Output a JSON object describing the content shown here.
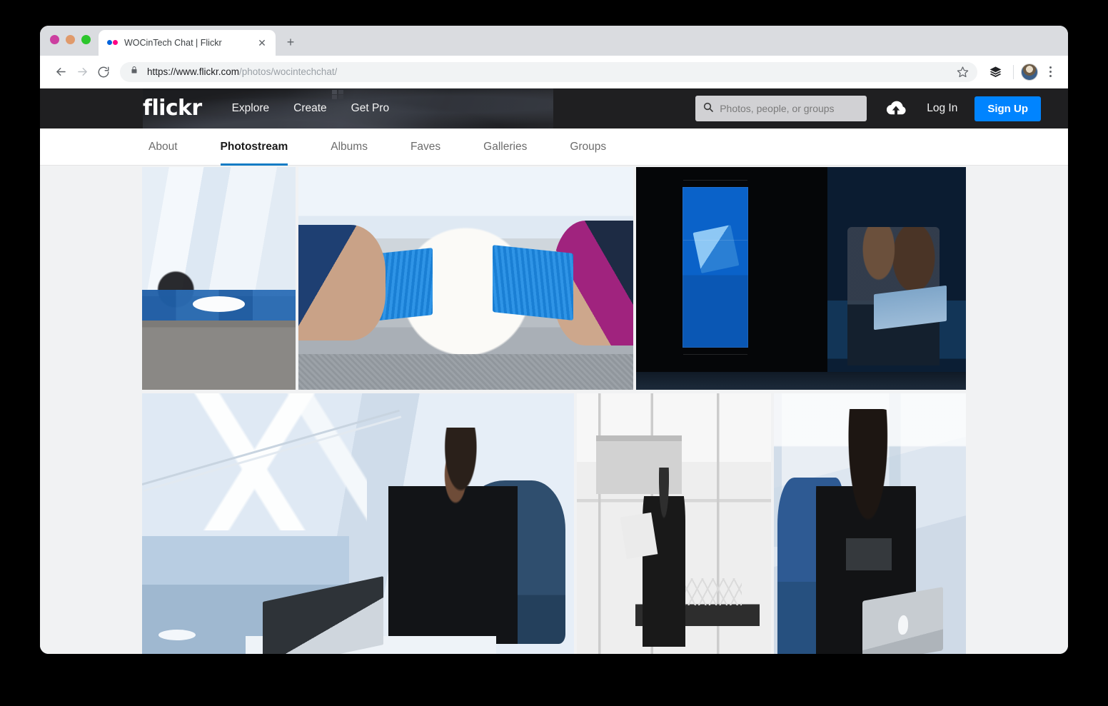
{
  "browser": {
    "tab": {
      "title": "WOCinTech Chat | Flickr",
      "favicon": "flickr-dots-icon",
      "close_label": "✕",
      "new_tab_label": "+"
    },
    "toolbar": {
      "back_label": "back-arrow",
      "forward_label": "forward-arrow",
      "reload_label": "reload-arrow",
      "lock_label": "lock-icon",
      "url_bold": "https://www.flickr.com",
      "url_rest": "/photos/wocintechchat/",
      "url_full": "https://www.flickr.com/photos/wocintechchat/",
      "star_label": "bookmark-star",
      "extension_label": "layers-extension",
      "profile_label": "user-avatar",
      "menu_label": "three-dot-menu"
    },
    "traffic_lights": {
      "close": "#cc3fa0",
      "minimize": "#e09a6b",
      "maximize": "#2cc62c"
    }
  },
  "site": {
    "logo": "flickr",
    "header_links": [
      {
        "label": "Explore"
      },
      {
        "label": "Create"
      },
      {
        "label": "Get Pro"
      }
    ],
    "search": {
      "placeholder": "Photos, people, or groups",
      "value": "",
      "icon": "search-icon"
    },
    "upload_icon": "cloud-upload-icon",
    "login_label": "Log In",
    "signup_label": "Sign Up",
    "accent_color": "#0084ff",
    "header_bg": "#1f1f21"
  },
  "profile_nav": {
    "active": "Photostream",
    "underline_color": "#0f7bc4",
    "tabs": [
      {
        "label": "About",
        "active": false
      },
      {
        "label": "Photostream",
        "active": true
      },
      {
        "label": "Albums",
        "active": false
      },
      {
        "label": "Faves",
        "active": false
      },
      {
        "label": "Galleries",
        "active": false
      },
      {
        "label": "Groups",
        "active": false
      }
    ]
  },
  "photostream": {
    "rows": [
      {
        "photos": [
          {
            "alt": "Woman working on laptop at round white table by window in blue lounge"
          },
          {
            "alt": "Overhead view of two pairs of hands typing on blue Surface keyboards at a round table"
          },
          {
            "alt": "Two people looking at a laptop beside a blue digital video wall display"
          }
        ]
      },
      {
        "photos": [
          {
            "alt": "Woman in black seated in blue chair using laptop by a window overlooking a marina"
          },
          {
            "alt": "Black and white photo of woman reading a document by a tall window"
          },
          {
            "alt": "Woman with curly hair in black top typing on a silver laptop in a blue chair"
          }
        ]
      }
    ]
  }
}
